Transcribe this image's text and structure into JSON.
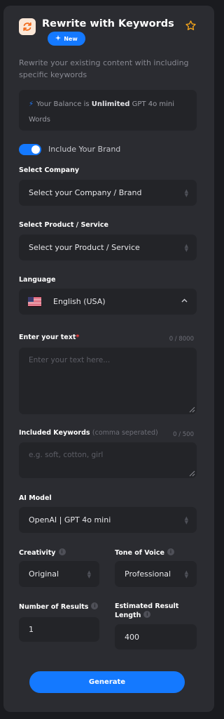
{
  "header": {
    "title": "Rewrite with Keywords",
    "badge": "New",
    "icons": {
      "app": "refresh-icon",
      "favorite": "star-outline-icon",
      "badge": "sparkle-icon"
    },
    "accent_color": "#1479ff",
    "icon_color": "#f26b1d"
  },
  "description": "Rewrite your existing content with including specific keywords",
  "balance": {
    "prefix": "Your Balance is",
    "amount": "Unlimited",
    "model": "GPT 4o mini",
    "unit": "Words"
  },
  "brand_toggle": {
    "label": "Include Your Brand",
    "on": true
  },
  "company": {
    "label": "Select Company",
    "value": "Select your Company / Brand"
  },
  "product": {
    "label": "Select Product / Service",
    "value": "Select your Product / Service"
  },
  "language": {
    "label": "Language",
    "value": "English (USA)",
    "flag": "us-flag-icon"
  },
  "text_input": {
    "label": "Enter your text",
    "required_mark": "*",
    "counter": "0 / 8000",
    "placeholder": "Enter your text here..."
  },
  "keywords": {
    "label": "Included Keywords",
    "hint": "(comma seperated)",
    "counter": "0 / 500",
    "placeholder": "e.g. soft, cotton, girl"
  },
  "ai_model": {
    "label": "AI Model",
    "value": "OpenAI | GPT 4o mini"
  },
  "creativity": {
    "label": "Creativity",
    "value": "Original"
  },
  "tone": {
    "label": "Tone of Voice",
    "value": "Professional"
  },
  "results": {
    "label": "Number of Results",
    "value": "1"
  },
  "length": {
    "label_line1": "Estimated Result",
    "label_line2": "Length",
    "value": "400"
  },
  "generate_label": "Generate"
}
